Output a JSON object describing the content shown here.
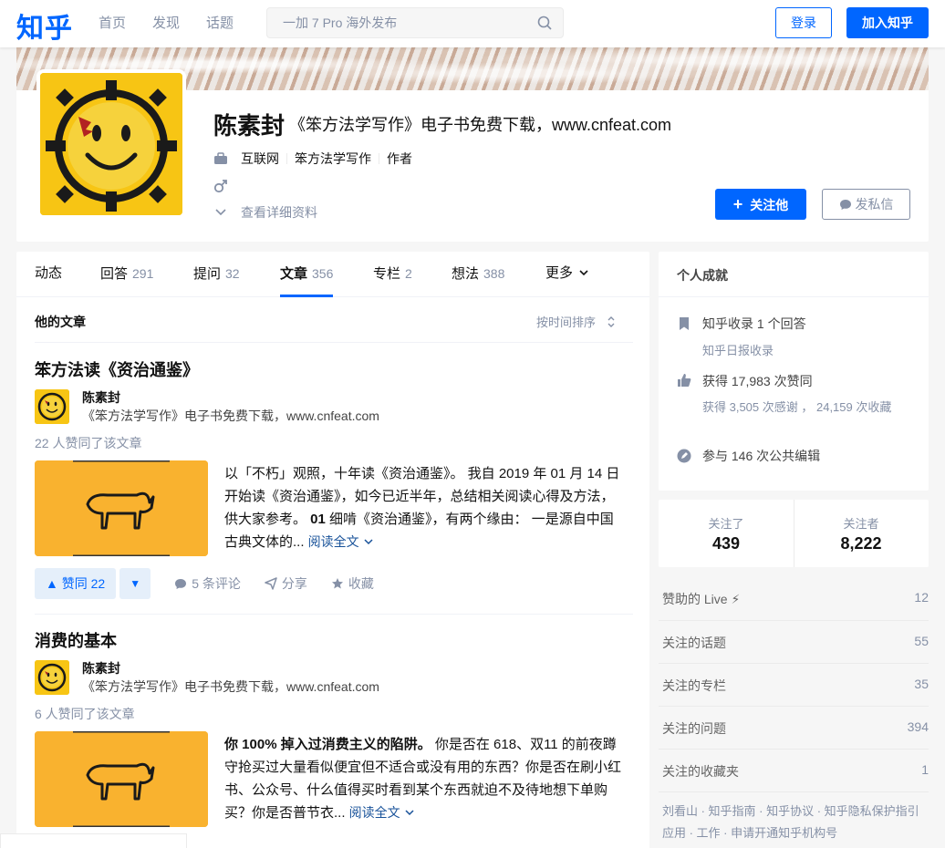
{
  "header": {
    "logo": "知乎",
    "nav": [
      "首页",
      "发现",
      "话题"
    ],
    "search_placeholder": "一加 7 Pro 海外发布",
    "login": "登录",
    "join": "加入知乎"
  },
  "profile": {
    "name": "陈素封",
    "headline": "《笨方法学写作》电子书免费下载，www.cnfeat.com",
    "industry": "互联网",
    "company": "笨方法学写作",
    "position": "作者",
    "gender_icon": "male-icon",
    "more_info": "查看详细资料",
    "follow_button": "关注他",
    "message_button": "发私信"
  },
  "tabs": [
    {
      "label": "动态",
      "count": ""
    },
    {
      "label": "回答",
      "count": "291"
    },
    {
      "label": "提问",
      "count": "32"
    },
    {
      "label": "文章",
      "count": "356"
    },
    {
      "label": "专栏",
      "count": "2"
    },
    {
      "label": "想法",
      "count": "388"
    },
    {
      "label": "更多",
      "count": ""
    }
  ],
  "list": {
    "title": "他的文章",
    "sort_label": "按时间排序"
  },
  "articles": [
    {
      "title": "笨方法读《资治通鉴》",
      "author": "陈素封",
      "author_headline": "《笨方法学写作》电子书免费下载，www.cnfeat.com",
      "likes": "22 人赞同了该文章",
      "excerpt_plain": "以「不朽」观照，十年读《资治通鉴》。 我自 2019 年 01 月 14 日开始读《资治通鉴》，如今已近半年，总结相关阅读心得及方法，供大家参考。 ",
      "excerpt_bold": "01",
      "excerpt_tail": " 细啃《资治通鉴》，有两个缘由： 一是源自中国古典文体的... ",
      "read_more": "阅读全文",
      "vote": "赞同 22",
      "comments": "5 条评论",
      "share": "分享",
      "collect": "收藏"
    },
    {
      "title": "消费的基本",
      "author": "陈素封",
      "author_headline": "《笨方法学写作》电子书免费下载，www.cnfeat.com",
      "likes": "6 人赞同了该文章",
      "excerpt_bold": "你 100% 掉入过消费主义的陷阱。",
      "excerpt_tail": " 你是否在 618、双11 的前夜蹲守抢买过大量看似便宜但不适合或没有用的东西？你是否在刷小红书、公众号、什么值得买时看到某个东西就迫不及待地想下单购买？你是否普节衣... ",
      "read_more": "阅读全文"
    }
  ],
  "achievements": {
    "title": "个人成就",
    "collect_line": "知乎收录 1 个回答",
    "collect_sub": "知乎日报收录",
    "like_line": "获得 17,983 次赞同",
    "like_sub": "获得 3,505 次感谢 ， 24,159 次收藏",
    "edit_line": "参与 146 次公共编辑"
  },
  "follow_stats": {
    "following_label": "关注了",
    "following": "439",
    "followers_label": "关注者",
    "followers": "8,222"
  },
  "side_list": [
    {
      "label": "赞助的 Live ⚡",
      "value": "12"
    },
    {
      "label": "关注的话题",
      "value": "55"
    },
    {
      "label": "关注的专栏",
      "value": "35"
    },
    {
      "label": "关注的问题",
      "value": "394"
    },
    {
      "label": "关注的收藏夹",
      "value": "1"
    }
  ],
  "footer_links": "刘看山 · 知乎指南 · 知乎协议 · 知乎隐私保护指引 应用 · 工作 · 申请开通知乎机构号",
  "colors": {
    "brand": "#0066ff",
    "avatar_bg": "#f7c514",
    "thumb_bg": "#f9b22f"
  }
}
